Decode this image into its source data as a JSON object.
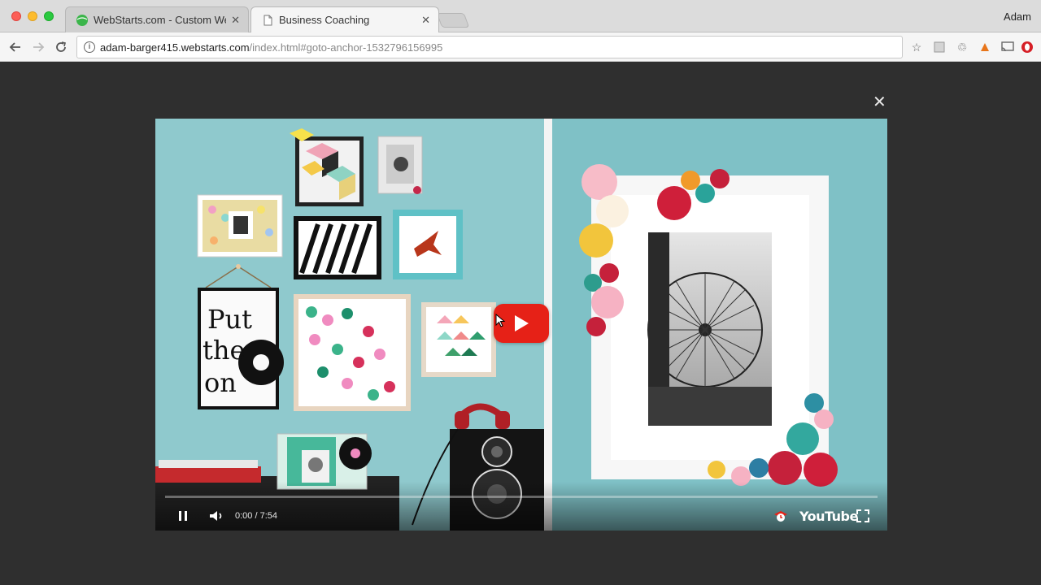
{
  "window": {
    "profile_name": "Adam"
  },
  "tabs": [
    {
      "label": "WebStarts.com - Custom Web",
      "active": false,
      "favicon": "webstarts-green-globe-icon"
    },
    {
      "label": "Business Coaching",
      "active": true,
      "favicon": "page-document-icon"
    }
  ],
  "address_bar": {
    "host": "adam-barger415.webstarts.com",
    "path": "/index.html#goto-anchor-1532796156995"
  },
  "toolbar_icons": [
    "back-icon",
    "forward-icon",
    "reload-icon",
    "info-icon",
    "bookmark-star-icon",
    "extension-icon",
    "recycle-icon",
    "extension-orange-icon",
    "cast-icon",
    "opera-icon"
  ],
  "video": {
    "time_display": "0:00 / 7:54",
    "progress": 0,
    "brand": "YouTube",
    "colors": {
      "play_red": "#e62117",
      "wall_blue": "#8cc6cb"
    }
  },
  "artwork_text": {
    "line1": "Put",
    "line2": "the",
    "line3": "on"
  },
  "captions_behind": [
    "",
    "",
    ""
  ]
}
